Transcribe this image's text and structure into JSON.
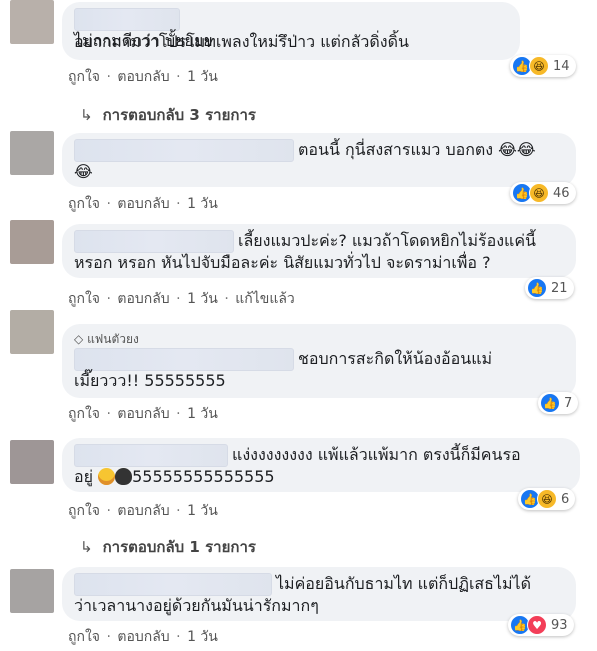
{
  "comments": [
    {
      "avatar_color": "#b8b0aa",
      "text_line1": "อยากถามว่าโปรโมทเพลงใหม่รึป่าว แต่กลัวดิ่งดิ้น",
      "text_line2": "ไม่ถามดีกว่า บั้ยยยย",
      "like": "ถูกใจ",
      "reply": "ตอบกลับ",
      "time": "1 วัน",
      "reaction_count": "14",
      "replies_label": "การตอบกลับ 3 รายการ"
    },
    {
      "avatar_color": "#aaa7a5",
      "text_line1": "ตอนนี้ กุนี่สงสารแมว บอกตง 😂😂",
      "text_line2": "😂",
      "like": "ถูกใจ",
      "reply": "ตอบกลับ",
      "time": "1 วัน",
      "reaction_count": "46"
    },
    {
      "avatar_color": "#a89c96",
      "text_line1": "เลี้ยงแมวปะค่ะ? แมวถ้าโดดหยิกไม่ร้องแค่นี้",
      "text_line2": "หรอก หรอก หันไปจับมือละค่ะ นิสัยแมวทั่วไป จะดราม่าเพื่อ ?",
      "like": "ถูกใจ",
      "reply": "ตอบกลับ",
      "time": "1 วัน",
      "edited": "แก้ไขแล้ว",
      "reaction_count": "21"
    },
    {
      "avatar_color": "#b3ada5",
      "badge": "แฟนตัวยง",
      "text_line1": "ชอบการสะกิดให้น้องอ้อนแม่",
      "text_line2": "เมี๊ยววว!! 55555555",
      "like": "ถูกใจ",
      "reply": "ตอบกลับ",
      "time": "1 วัน",
      "reaction_count": "7"
    },
    {
      "avatar_color": "#9e9696",
      "text_line1": "แง่งงงงงงงง แพ้แล้วแพ้มาก ตรงนี้ก็มีคนรอ",
      "text_line2_prefix": "อยู่",
      "text_line2": "55555555555555",
      "like": "ถูกใจ",
      "reply": "ตอบกลับ",
      "time": "1 วัน",
      "reaction_count": "6",
      "replies_label": "การตอบกลับ 1 รายการ"
    },
    {
      "avatar_color": "#a6a3a2",
      "text_line1": "ไม่ค่อยอินกับธามไท แต่ก็ปฏิเสธไม่ได้",
      "text_line2": "ว่าเวลานางอยู่ด้วยกันมันน่ารักมากๆ",
      "like": "ถูกใจ",
      "reply": "ตอบกลับ",
      "time": "1 วัน",
      "reaction_count": "93"
    }
  ],
  "reply_arrow": "↳",
  "separator": "·",
  "icons": {
    "like": "like-reaction-icon",
    "haha": "haha-reaction-icon",
    "love": "love-reaction-icon",
    "badge": "diamond-icon"
  },
  "colors": {
    "bubble": "#f0f2f5",
    "like_blue": "#1877f2",
    "haha_yellow": "#f7b928",
    "love_red": "#f33e58"
  }
}
